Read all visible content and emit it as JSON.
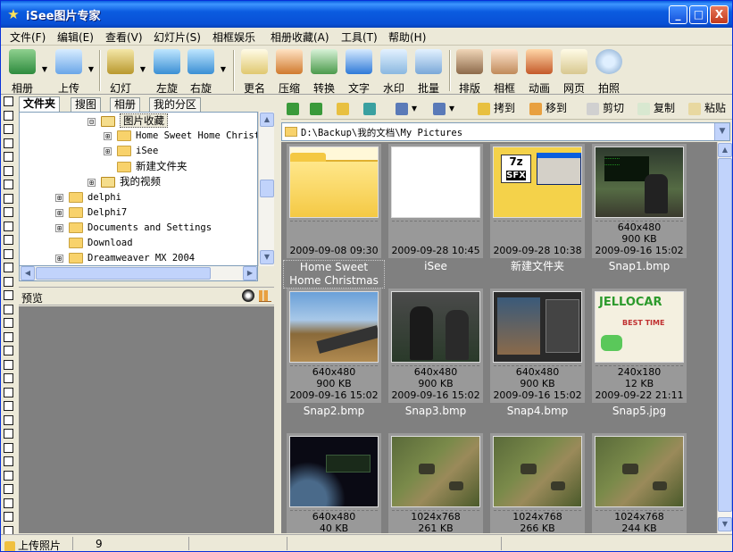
{
  "window": {
    "title": "iSee图片专家",
    "minimize": "_",
    "maximize": "□",
    "close": "X"
  },
  "menu": [
    "文件(F)",
    "编辑(E)",
    "查看(V)",
    "幻灯片(S)",
    "相框娱乐",
    "相册收藏(A)",
    "工具(T)",
    "帮助(H)"
  ],
  "toolbar": {
    "album": "相册",
    "upload": "上传",
    "slideshow": "幻灯",
    "rotate_left": "左旋",
    "rotate_right": "右旋",
    "rename": "更名",
    "compress": "压缩",
    "convert": "转换",
    "text": "文字",
    "watermark": "水印",
    "batch": "批量",
    "layout": "排版",
    "frame": "相框",
    "animation": "动画",
    "webpage": "网页",
    "photo": "拍照"
  },
  "left_tabs": [
    "文件夹",
    "搜图",
    "相册",
    "我的分区"
  ],
  "tree": [
    {
      "label": "图片收藏",
      "toggle": "⊟",
      "selected": true
    },
    {
      "label": "Home Sweet Home Christmas",
      "toggle": "⊞"
    },
    {
      "label": "iSee",
      "toggle": "⊞"
    },
    {
      "label": "新建文件夹",
      "toggle": ""
    },
    {
      "label": "我的视频",
      "toggle": "⊞"
    },
    {
      "label": "delphi",
      "toggle": "⊞"
    },
    {
      "label": "Delphi7",
      "toggle": "⊞"
    },
    {
      "label": "Documents and Settings",
      "toggle": "⊞"
    },
    {
      "label": "Download",
      "toggle": ""
    },
    {
      "label": "Dreamweaver MX 2004",
      "toggle": "⊞"
    }
  ],
  "preview": {
    "label": "预览"
  },
  "nav": {
    "cut_to": "移到",
    "copy_to": "移到",
    "cut": "剪切",
    "copy": "复制",
    "paste": "粘贴",
    "paste_to": "拷到"
  },
  "path": "D:\\Backup\\我的文档\\My Pictures",
  "items": [
    {
      "caption": "Home Sweet Home Christmas",
      "l1": "",
      "l2": "",
      "l3": "2009-09-08 09:30",
      "type": "folder"
    },
    {
      "caption": "iSee",
      "l1": "",
      "l2": "",
      "l3": "2009-09-28 10:45",
      "type": "blank"
    },
    {
      "caption": "新建文件夹",
      "l1": "",
      "l2": "",
      "l3": "2009-09-28 10:38",
      "type": "sfx"
    },
    {
      "caption": "Snap1.bmp",
      "l1": "640x480",
      "l2": "900 KB",
      "l3": "2009-09-16 15:02",
      "type": "game1"
    },
    {
      "caption": "Snap2.bmp",
      "l1": "640x480",
      "l2": "900 KB",
      "l3": "2009-09-16 15:02",
      "type": "game2"
    },
    {
      "caption": "Snap3.bmp",
      "l1": "640x480",
      "l2": "900 KB",
      "l3": "2009-09-16 15:02",
      "type": "game3"
    },
    {
      "caption": "Snap4.bmp",
      "l1": "640x480",
      "l2": "900 KB",
      "l3": "2009-09-16 15:02",
      "type": "game4"
    },
    {
      "caption": "Snap5.jpg",
      "l1": "240x180",
      "l2": "12 KB",
      "l3": "2009-09-22 21:11",
      "type": "jello"
    },
    {
      "caption": "",
      "l1": "640x480",
      "l2": "40 KB",
      "l3": "",
      "type": "space"
    },
    {
      "caption": "",
      "l1": "1024x768",
      "l2": "261 KB",
      "l3": "",
      "type": "terrain"
    },
    {
      "caption": "",
      "l1": "1024x768",
      "l2": "266 KB",
      "l3": "",
      "type": "terrain"
    },
    {
      "caption": "",
      "l1": "1024x768",
      "l2": "244 KB",
      "l3": "",
      "type": "terrain"
    }
  ],
  "sfx_text": {
    "a": "7z",
    "b": "SFX"
  },
  "jello_text": {
    "a": "JELLOCAR",
    "b": "BEST TIME"
  },
  "status": {
    "upload": "上传照片",
    "count": "9"
  }
}
